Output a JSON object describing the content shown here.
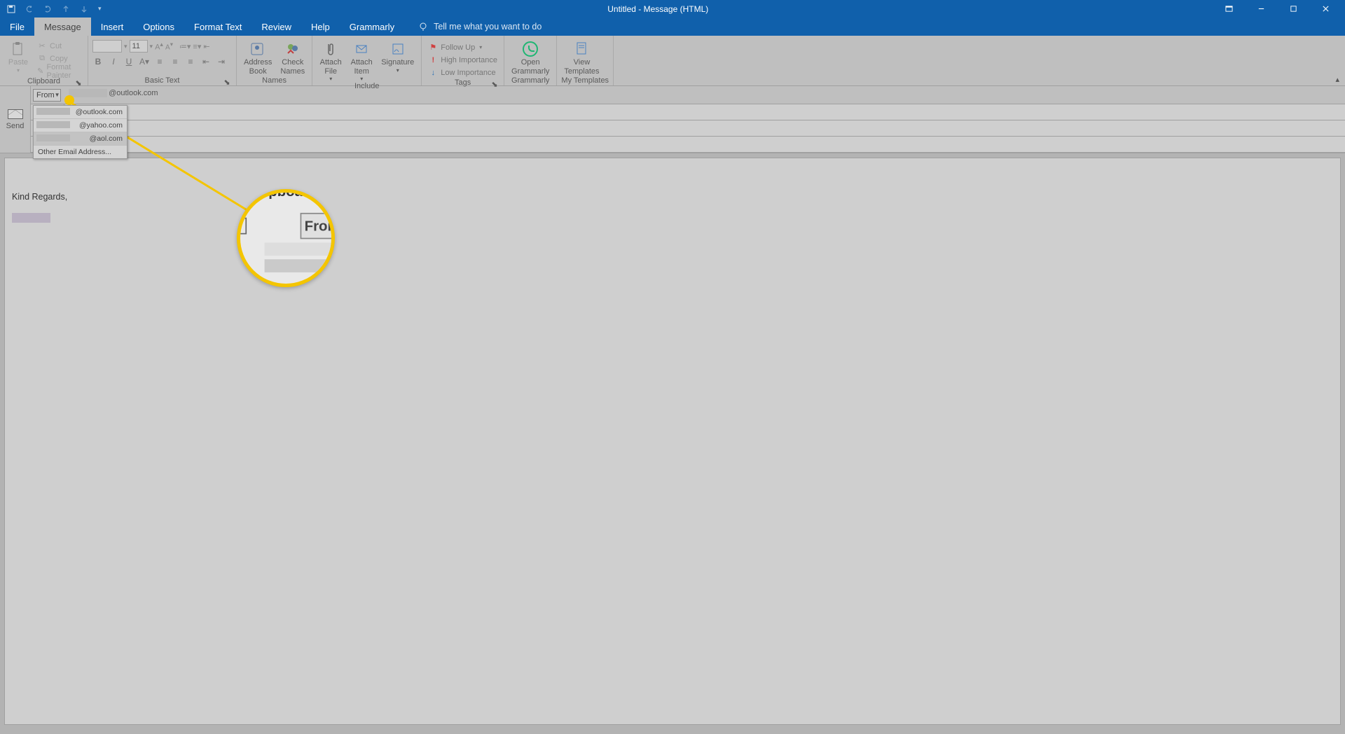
{
  "window": {
    "title": "Untitled - Message (HTML)"
  },
  "tabs": {
    "file": "File",
    "message": "Message",
    "insert": "Insert",
    "options": "Options",
    "format_text": "Format Text",
    "review": "Review",
    "help": "Help",
    "grammarly": "Grammarly",
    "tell_me": "Tell me what you want to do"
  },
  "ribbon": {
    "clipboard": {
      "label": "Clipboard",
      "paste": "Paste",
      "cut": "Cut",
      "copy": "Copy",
      "format_painter": "Format Painter"
    },
    "basic_text": {
      "label": "Basic Text",
      "font_size": "11"
    },
    "names": {
      "label": "Names",
      "address_book": "Address\nBook",
      "check_names": "Check\nNames"
    },
    "include": {
      "label": "Include",
      "attach_file": "Attach\nFile",
      "attach_item": "Attach\nItem",
      "signature": "Signature"
    },
    "tags": {
      "label": "Tags",
      "follow_up": "Follow Up",
      "high_importance": "High Importance",
      "low_importance": "Low Importance"
    },
    "grammarly": {
      "label": "Grammarly",
      "open": "Open\nGrammarly"
    },
    "templates": {
      "label": "My Templates",
      "view": "View\nTemplates"
    }
  },
  "compose": {
    "send": "Send",
    "from": "From",
    "from_address": "@outlook.com",
    "dropdown": {
      "items": [
        "@outlook.com",
        "@yahoo.com",
        "@aol.com"
      ],
      "other": "Other Email Address..."
    }
  },
  "body": {
    "signature": "Kind Regards,"
  },
  "magnifier": {
    "clipboard": "Clipboard",
    "from": "From"
  }
}
